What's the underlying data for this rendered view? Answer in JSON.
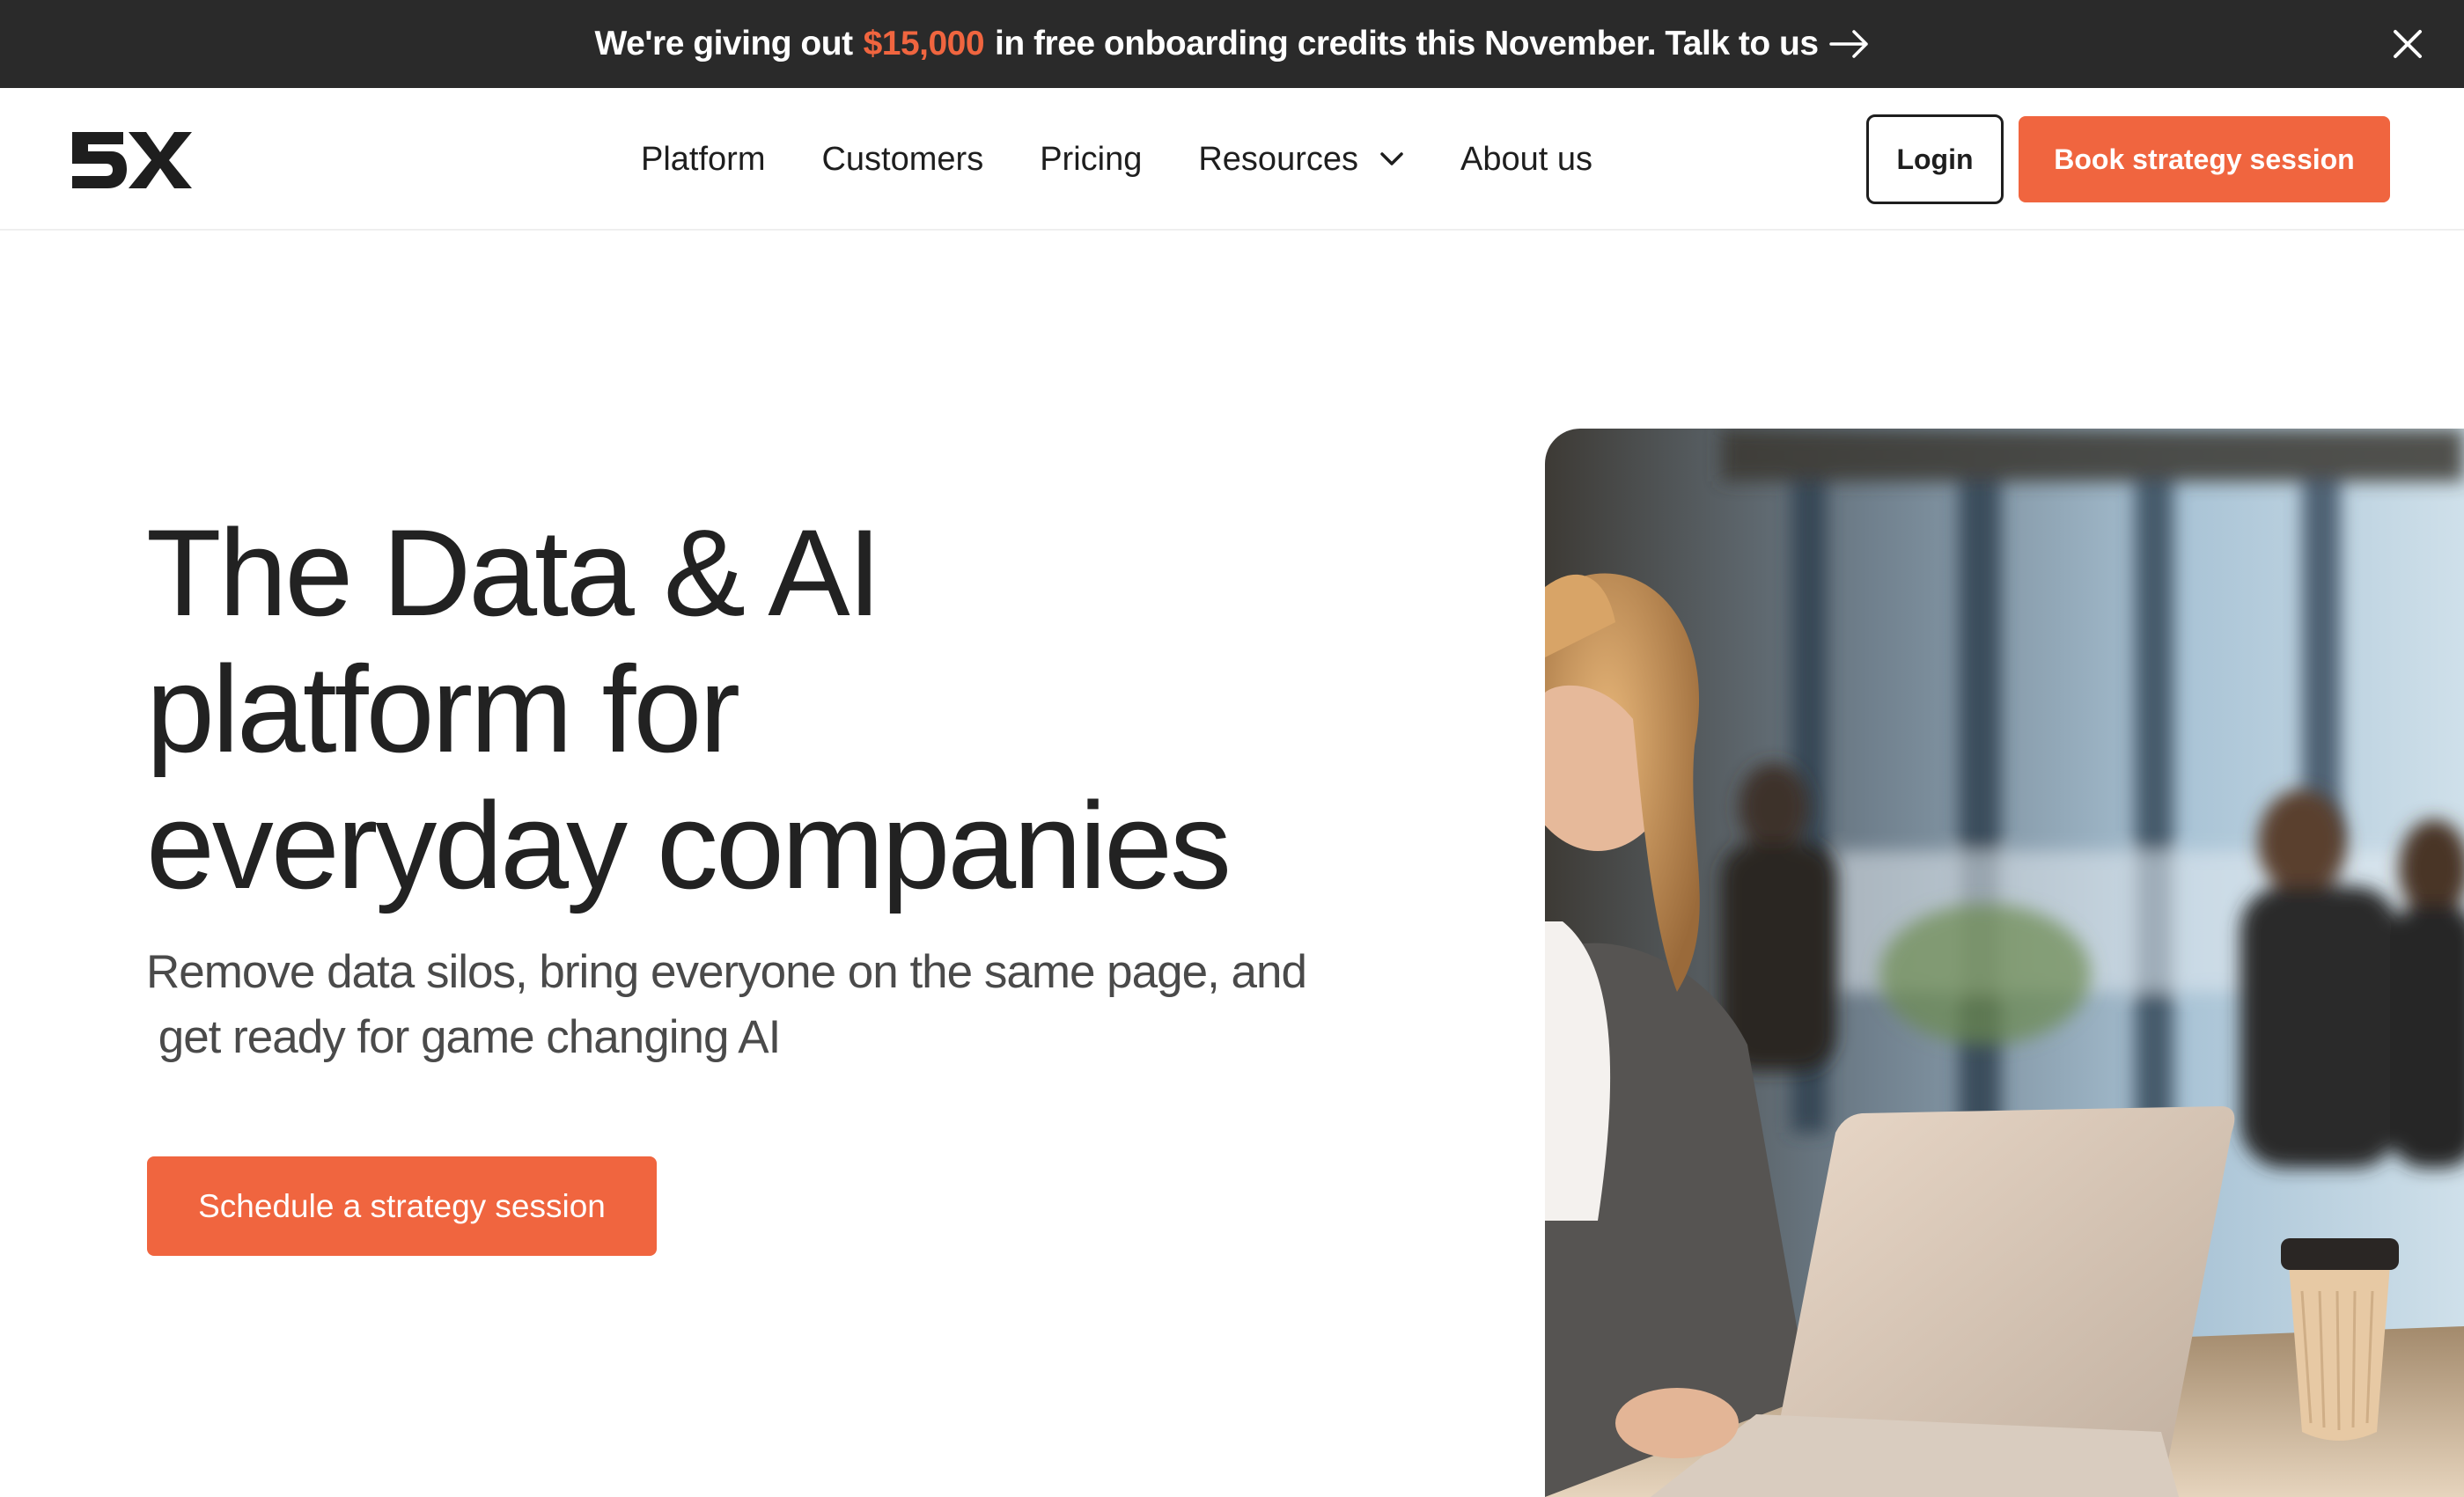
{
  "announcement": {
    "prefix": "We're giving out",
    "amount": "$15,000",
    "suffix": "in free onboarding credits this November. Talk to us",
    "arrow_icon": "arrow-right-icon",
    "close_icon": "close-icon"
  },
  "nav": {
    "logo_text": "5X",
    "items": [
      {
        "label": "Platform"
      },
      {
        "label": "Customers"
      },
      {
        "label": "Pricing"
      },
      {
        "label": "Resources",
        "icon": "chevron-down-icon"
      },
      {
        "label": "About us"
      }
    ],
    "login_label": "Login",
    "book_label": "Book strategy session"
  },
  "hero": {
    "headline_lines": [
      "The Data & AI",
      "platform for",
      "everyday companies"
    ],
    "subtitle_line1": "Remove data silos, bring everyone on the same page, and",
    "subtitle_line2": " get ready for game changing AI",
    "cta_label": "Schedule a strategy session"
  },
  "colors": {
    "accent": "#f0653f",
    "announcement_bg": "#2a2a2a",
    "text": "#222222"
  }
}
